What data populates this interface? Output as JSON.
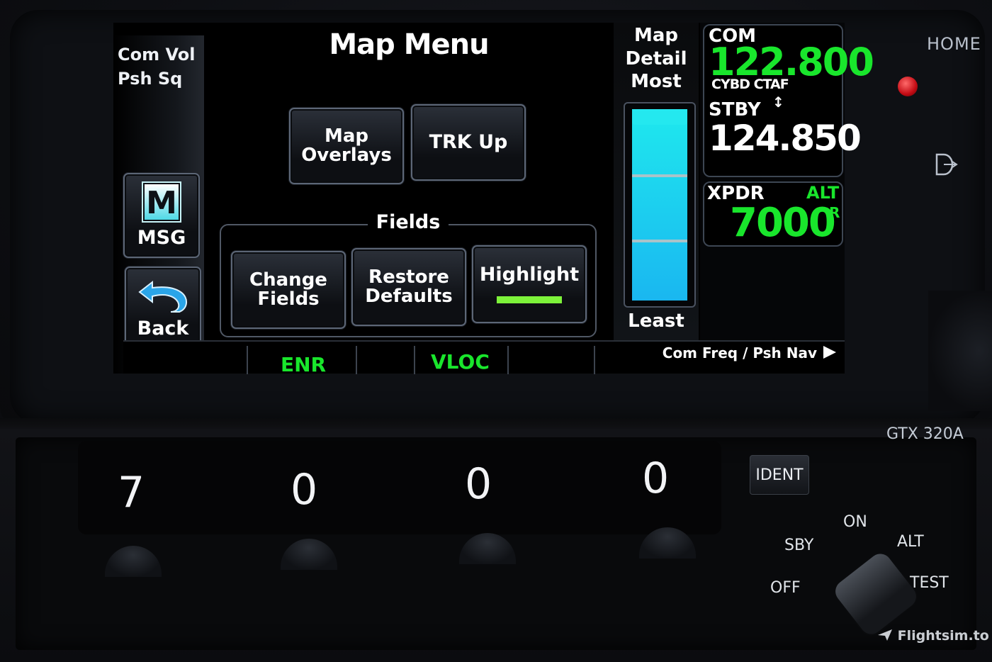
{
  "side": {
    "vol_line1": "Com Vol",
    "vol_line2": "Psh Sq",
    "msg_glyph": "M",
    "msg_label": "MSG",
    "back_label": "Back"
  },
  "main": {
    "title": "Map Menu",
    "map_overlays_line1": "Map",
    "map_overlays_line2": "Overlays",
    "trk_up": "TRK Up",
    "fields_label": "Fields",
    "change_line1": "Change",
    "change_line2": "Fields",
    "restore_line1": "Restore",
    "restore_line2": "Defaults",
    "highlight": "Highlight"
  },
  "detail": {
    "title_line1": "Map",
    "title_line2": "Detail",
    "most": "Most",
    "least": "Least",
    "level_fraction": 1.0
  },
  "radio": {
    "com_label": "COM",
    "com_active": "122.800",
    "com_id": "CYBD CTAF",
    "stby_label": "STBY",
    "com_standby": "124.850",
    "xpdr_label": "XPDR",
    "xpdr_mode": "ALT",
    "xpdr_code": "7000",
    "xpdr_reply": "R"
  },
  "status_bar": {
    "enr": "ENR",
    "vloc": "VLOC",
    "com_nav": "Com Freq / Psh Nav"
  },
  "bezel": {
    "home": "HOME"
  },
  "transponder": {
    "model": "GTX 320A",
    "digits": [
      "7",
      "0",
      "0",
      "0"
    ],
    "ident": "IDENT",
    "mode_on": "ON",
    "mode_sby": "SBY",
    "mode_alt": "ALT",
    "mode_off": "OFF",
    "mode_test": "TEST"
  },
  "watermark": "Flightsim.to",
  "colors": {
    "active_green": "#19e62c",
    "highlight_green": "#7df23a",
    "slider_cyan": "#1fe8ee",
    "led_red": "#e01820"
  }
}
